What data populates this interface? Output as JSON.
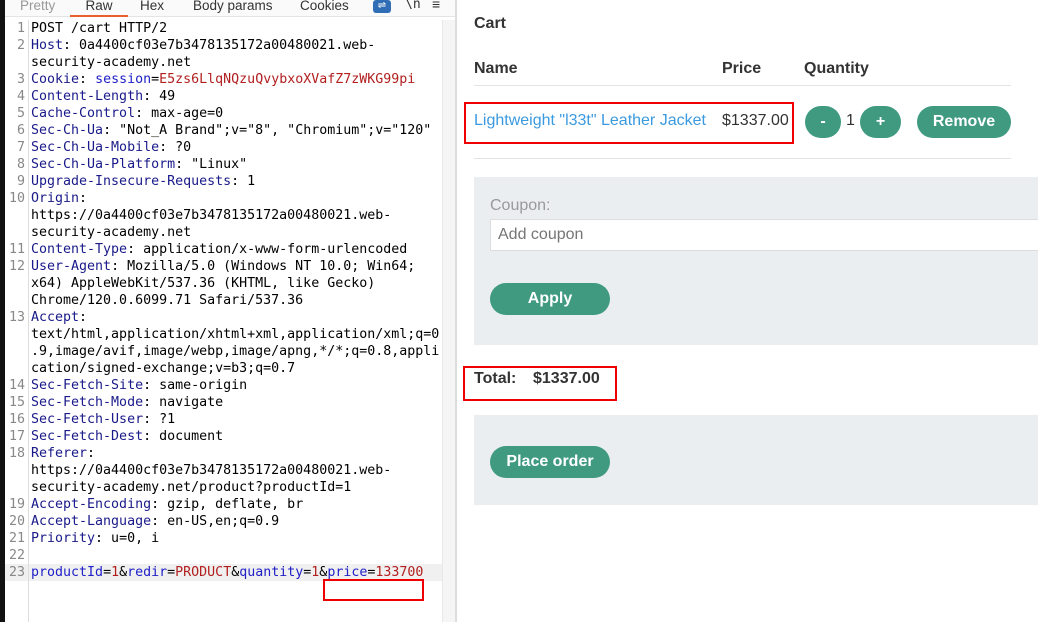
{
  "tabs": [
    {
      "label": "Pretty",
      "state": "dim"
    },
    {
      "label": "Raw",
      "state": "active"
    },
    {
      "label": "Hex",
      "state": ""
    },
    {
      "label": "Body params",
      "state": ""
    },
    {
      "label": "Cookies",
      "state": ""
    }
  ],
  "toolbar": {
    "wrap_icon": "word-wrap-icon",
    "newline_label": "\\n",
    "menu_icon": "hamburger-menu-icon"
  },
  "request_lines": [
    [
      [
        "t",
        "POST /cart HTTP/2"
      ]
    ],
    [
      [
        "k",
        "Host"
      ],
      [
        "t",
        ": 0a4400cf03e7b3478135172a00480021.web-security-academy.net"
      ]
    ],
    [
      [
        "k",
        "Cookie"
      ],
      [
        "t",
        ": "
      ],
      [
        "p",
        "session"
      ],
      [
        "t",
        "="
      ],
      [
        "v",
        "E5zs6LlqNQzuQvybxoXVafZ7zWKG99pi"
      ]
    ],
    [
      [
        "k",
        "Content-Length"
      ],
      [
        "t",
        ": 49"
      ]
    ],
    [
      [
        "k",
        "Cache-Control"
      ],
      [
        "t",
        ": max-age=0"
      ]
    ],
    [
      [
        "k",
        "Sec-Ch-Ua"
      ],
      [
        "t",
        ": \"Not_A Brand\";v=\"8\", \"Chromium\";v=\"120\""
      ]
    ],
    [
      [
        "k",
        "Sec-Ch-Ua-Mobile"
      ],
      [
        "t",
        ": ?0"
      ]
    ],
    [
      [
        "k",
        "Sec-Ch-Ua-Platform"
      ],
      [
        "t",
        ": \"Linux\""
      ]
    ],
    [
      [
        "k",
        "Upgrade-Insecure-Requests"
      ],
      [
        "t",
        ": 1"
      ]
    ],
    [
      [
        "k",
        "Origin"
      ],
      [
        "t",
        ": https://0a4400cf03e7b3478135172a00480021.web-security-academy.net"
      ]
    ],
    [
      [
        "k",
        "Content-Type"
      ],
      [
        "t",
        ": application/x-www-form-urlencoded"
      ]
    ],
    [
      [
        "k",
        "User-Agent"
      ],
      [
        "t",
        ": Mozilla/5.0 (Windows NT 10.0; Win64; x64) AppleWebKit/537.36 (KHTML, like Gecko) Chrome/120.0.6099.71 Safari/537.36"
      ]
    ],
    [
      [
        "k",
        "Accept"
      ],
      [
        "t",
        ": text/html,application/xhtml+xml,application/xml;q=0.9,image/avif,image/webp,image/apng,*/*;q=0.8,application/signed-exchange;v=b3;q=0.7"
      ]
    ],
    [
      [
        "k",
        "Sec-Fetch-Site"
      ],
      [
        "t",
        ": same-origin"
      ]
    ],
    [
      [
        "k",
        "Sec-Fetch-Mode"
      ],
      [
        "t",
        ": navigate"
      ]
    ],
    [
      [
        "k",
        "Sec-Fetch-User"
      ],
      [
        "t",
        ": ?1"
      ]
    ],
    [
      [
        "k",
        "Sec-Fetch-Dest"
      ],
      [
        "t",
        ": document"
      ]
    ],
    [
      [
        "k",
        "Referer"
      ],
      [
        "t",
        ": https://0a4400cf03e7b3478135172a00480021.web-security-academy.net/product?productId=1"
      ]
    ],
    [
      [
        "k",
        "Accept-Encoding"
      ],
      [
        "t",
        ": gzip, deflate, br"
      ]
    ],
    [
      [
        "k",
        "Accept-Language"
      ],
      [
        "t",
        ": en-US,en;q=0.9"
      ]
    ],
    [
      [
        "k",
        "Priority"
      ],
      [
        "t",
        ": u=0, i"
      ]
    ],
    [],
    [
      [
        "p",
        "productId"
      ],
      [
        "t",
        "="
      ],
      [
        "v",
        "1"
      ],
      [
        "t",
        "&"
      ],
      [
        "p",
        "redir"
      ],
      [
        "t",
        "="
      ],
      [
        "v",
        "PRODUCT"
      ],
      [
        "t",
        "&"
      ],
      [
        "p",
        "quantity"
      ],
      [
        "t",
        "="
      ],
      [
        "v",
        "1"
      ],
      [
        "t",
        "&"
      ],
      [
        "p",
        "price"
      ],
      [
        "t",
        "="
      ],
      [
        "v",
        "133700"
      ]
    ]
  ],
  "cart": {
    "title": "Cart",
    "headers": {
      "name": "Name",
      "price": "Price",
      "quantity": "Quantity"
    },
    "item": {
      "name": "Lightweight \"l33t\" Leather Jacket",
      "price": "$1337.00",
      "quantity": "1",
      "minus": "-",
      "plus": "+",
      "remove": "Remove"
    },
    "coupon": {
      "label": "Coupon:",
      "placeholder": "Add coupon",
      "apply": "Apply"
    },
    "total": {
      "label": "Total:",
      "value": "$1337.00"
    },
    "place_order": "Place order"
  },
  "colors": {
    "accent": "#3f9a80",
    "link": "#3a9ae0",
    "highlight": "#e00000",
    "tab_active": "#e8602c"
  }
}
